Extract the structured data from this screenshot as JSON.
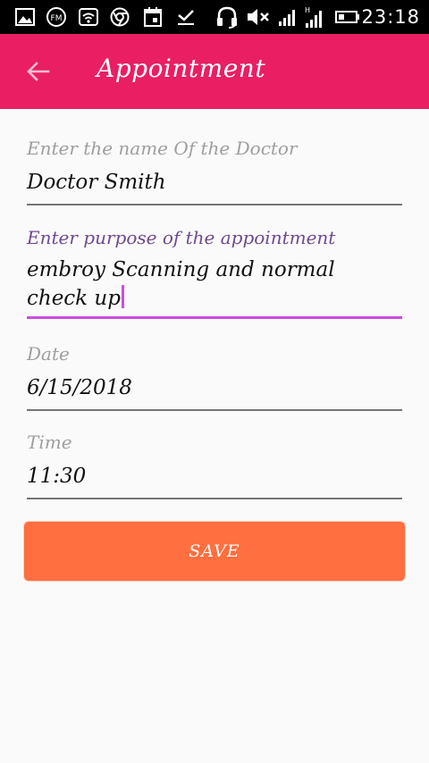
{
  "status_bar": {
    "time": "23:18",
    "icons": [
      "image-icon",
      "fm-radio-icon",
      "wifi-icon",
      "chrome-icon",
      "calendar-icon",
      "download-done-icon",
      "headset-icon",
      "mute-icon",
      "signal-icon",
      "signal-h-icon",
      "battery-icon"
    ],
    "h_label": "H",
    "fm_label": "FM"
  },
  "app_bar": {
    "title": "Appointment",
    "color": "#e91e63"
  },
  "form": {
    "doctor": {
      "label": "Enter the name Of the Doctor",
      "value": "Doctor Smith"
    },
    "purpose": {
      "label": "Enter purpose of the appointment",
      "value": "embroy Scanning and normal\ncheck up"
    },
    "date": {
      "label": "Date",
      "value": "6/15/2018"
    },
    "time": {
      "label": "Time",
      "value": "11:30"
    }
  },
  "save_label": "SAVE",
  "colors": {
    "accent": "#cc4de0",
    "button": "#ff6f3f"
  }
}
